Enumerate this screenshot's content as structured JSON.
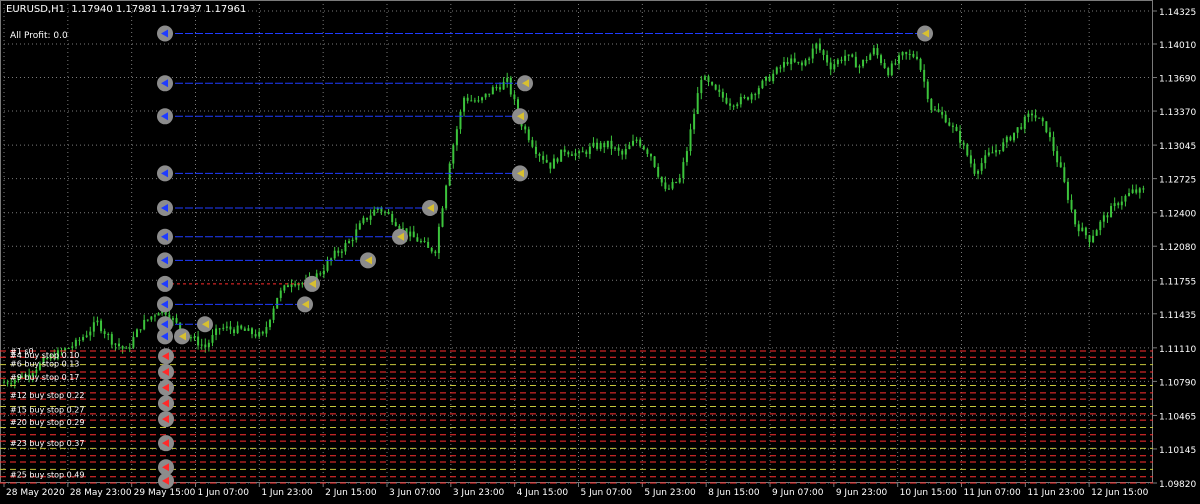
{
  "header": {
    "symbol": "EURUSD,H1",
    "quote": "1.17940 1.17981 1.17937 1.17961",
    "all_profit": "All Profit: 0.0"
  },
  "colors": {
    "background": "#000000",
    "grid": "#7a7a7a",
    "candle": "#3cc43c",
    "buy_line": "#1f3cff",
    "sell_line": "#ff2a2a",
    "stop_line": "#ff3030",
    "stop_line_alt": "#c8c83c",
    "marker": "#8c8c8c",
    "text": "#ffffff"
  },
  "chart_data": {
    "type": "candlestick",
    "symbol": "EURUSD",
    "timeframe": "H1",
    "ylim": [
      1.0982,
      1.1443
    ],
    "y_ticks": [
      1.14325,
      1.1401,
      1.1369,
      1.1337,
      1.13045,
      1.12725,
      1.124,
      1.1208,
      1.11755,
      1.11435,
      1.1111,
      1.1079,
      1.10465,
      1.10145,
      1.0982
    ],
    "y_tick_labels": [
      "1.14325",
      "1.14010",
      "1.13690",
      "1.13370",
      "1.13045",
      "1.12725",
      "1.12400",
      "1.12080",
      "1.11755",
      "1.11435",
      "1.11110",
      "1.10790",
      "1.10465",
      "1.10145",
      "1.09820"
    ],
    "x_tick_labels": [
      "28 May 2020",
      "28 May 23:00",
      "29 May 15:00",
      "1 Jun 07:00",
      "1 Jun 23:00",
      "2 Jun 15:00",
      "3 Jun 07:00",
      "3 Jun 23:00",
      "4 Jun 15:00",
      "5 Jun 07:00",
      "5 Jun 23:00",
      "8 Jun 15:00",
      "9 Jun 07:00",
      "9 Jun 23:00",
      "10 Jun 15:00",
      "11 Jun 07:00",
      "11 Jun 23:00",
      "12 Jun 15:00"
    ],
    "close_path": [
      [
        0,
        1.1078
      ],
      [
        6,
        1.1085
      ],
      [
        12,
        1.11
      ],
      [
        20,
        1.1115
      ],
      [
        26,
        1.1135
      ],
      [
        30,
        1.1118
      ],
      [
        34,
        1.1108
      ],
      [
        38,
        1.1132
      ],
      [
        44,
        1.115
      ],
      [
        50,
        1.1125
      ],
      [
        56,
        1.1112
      ],
      [
        60,
        1.113
      ],
      [
        66,
        1.1128
      ],
      [
        72,
        1.1122
      ],
      [
        76,
        1.116
      ],
      [
        80,
        1.1175
      ],
      [
        84,
        1.1172
      ],
      [
        88,
        1.1183
      ],
      [
        92,
        1.12
      ],
      [
        96,
        1.1212
      ],
      [
        100,
        1.1232
      ],
      [
        104,
        1.1245
      ],
      [
        108,
        1.1235
      ],
      [
        112,
        1.122
      ],
      [
        116,
        1.1212
      ],
      [
        118,
        1.1205
      ],
      [
        120,
        1.1205
      ],
      [
        124,
        1.129
      ],
      [
        128,
        1.135
      ],
      [
        132,
        1.1345
      ],
      [
        136,
        1.1358
      ],
      [
        140,
        1.1365
      ],
      [
        144,
        1.1325
      ],
      [
        148,
        1.13
      ],
      [
        152,
        1.1285
      ],
      [
        156,
        1.13
      ],
      [
        160,
        1.1295
      ],
      [
        164,
        1.1303
      ],
      [
        168,
        1.1305
      ],
      [
        172,
        1.1295
      ],
      [
        176,
        1.131
      ],
      [
        180,
        1.1295
      ],
      [
        184,
        1.126
      ],
      [
        188,
        1.1272
      ],
      [
        190,
        1.13
      ],
      [
        194,
        1.137
      ],
      [
        198,
        1.1355
      ],
      [
        202,
        1.1345
      ],
      [
        206,
        1.1348
      ],
      [
        210,
        1.136
      ],
      [
        214,
        1.1372
      ],
      [
        218,
        1.1385
      ],
      [
        222,
        1.138
      ],
      [
        226,
        1.14
      ],
      [
        230,
        1.138
      ],
      [
        234,
        1.139
      ],
      [
        238,
        1.138
      ],
      [
        242,
        1.1395
      ],
      [
        246,
        1.1375
      ],
      [
        250,
        1.139
      ],
      [
        254,
        1.139
      ],
      [
        258,
        1.134
      ],
      [
        262,
        1.133
      ],
      [
        266,
        1.131
      ],
      [
        270,
        1.128
      ],
      [
        274,
        1.1295
      ],
      [
        278,
        1.1305
      ],
      [
        282,
        1.132
      ],
      [
        286,
        1.1335
      ],
      [
        290,
        1.132
      ],
      [
        294,
        1.128
      ],
      [
        298,
        1.123
      ],
      [
        302,
        1.1215
      ],
      [
        306,
        1.1235
      ],
      [
        310,
        1.125
      ],
      [
        314,
        1.126
      ]
    ],
    "order_lines": [
      {
        "price": 1.1411,
        "type": "buy"
      },
      {
        "price": 1.13635,
        "type": "buy"
      },
      {
        "price": 1.1332,
        "type": "buy"
      },
      {
        "price": 1.12775,
        "type": "buy"
      },
      {
        "price": 1.12445,
        "type": "buy"
      },
      {
        "price": 1.1217,
        "type": "buy"
      },
      {
        "price": 1.11945,
        "type": "buy"
      },
      {
        "price": 1.1172,
        "type": "sell"
      },
      {
        "price": 1.11525,
        "type": "buy"
      },
      {
        "price": 1.11335,
        "type": "buy"
      },
      {
        "price": 1.1122,
        "type": "buy"
      }
    ],
    "stop_levels": [
      1.1108,
      1.1102,
      1.1095,
      1.1088,
      1.1082,
      1.1075,
      1.1068,
      1.1062,
      1.1055,
      1.1048,
      1.1042,
      1.1035,
      1.1028,
      1.1022,
      1.1015,
      1.1008,
      1.1002,
      1.0995,
      1.0988,
      1.0982
    ]
  },
  "stop_labels": [
    {
      "text": "#1 s0",
      "price": 1.1108
    },
    {
      "text": "#4 buy stop 0.10",
      "price": 1.1104
    },
    {
      "text": "#6 buy stop 0.13",
      "price": 1.1096
    },
    {
      "text": "#9 buy stop 0.17",
      "price": 1.1083
    },
    {
      "text": "#12 buy stop 0.22",
      "price": 1.1066
    },
    {
      "text": "#15 buy stop 0.27",
      "price": 1.1052
    },
    {
      "text": "#20 buy stop 0.29",
      "price": 1.104
    },
    {
      "text": "#23 buy stop 0.37",
      "price": 1.102
    },
    {
      "text": "#25 buy stop 0.49",
      "price": 1.099
    }
  ]
}
